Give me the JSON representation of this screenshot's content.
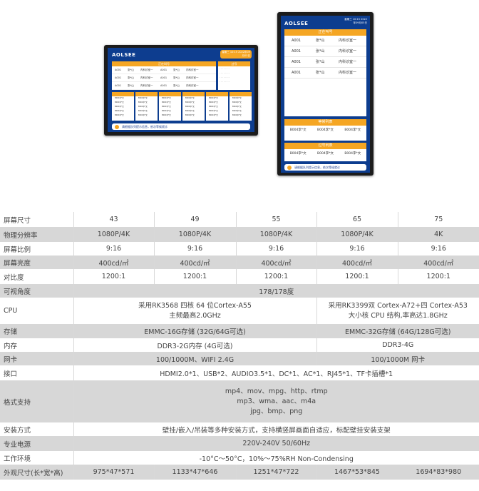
{
  "display": {
    "brand": "AOLSEE",
    "clock": "星期三 10:15 2022年09月05日",
    "sections": {
      "calling": "正在叫号",
      "waiting": "等候列表",
      "passed": "过号列表",
      "queue": "过号"
    },
    "calls": [
      {
        "id": "A001",
        "name": "张*山",
        "room": "内科诊室一"
      },
      {
        "id": "A001",
        "name": "张*山",
        "room": "内科诊室一"
      },
      {
        "id": "A001",
        "name": "张*山",
        "room": "内科诊室一"
      },
      {
        "id": "A001",
        "name": "张*山",
        "room": "内科诊室一"
      }
    ],
    "wait_items": [
      "B004李*文",
      "B004李*文",
      "B004李*文"
    ],
    "notice": "请根据队列提示信息，依次等候就诊"
  },
  "spec": {
    "rows": [
      {
        "label": "屏幕尺寸",
        "cells": [
          {
            "t": "43",
            "span": 1
          },
          {
            "t": "49",
            "span": 1
          },
          {
            "t": "55",
            "span": 1
          },
          {
            "t": "65",
            "span": 1
          },
          {
            "t": "75",
            "span": 1
          }
        ],
        "h": 21,
        "shade": "w"
      },
      {
        "label": "物理分辨率",
        "cells": [
          {
            "t": "1080P/4K",
            "span": 1
          },
          {
            "t": "1080P/4K",
            "span": 1
          },
          {
            "t": "1080P/4K",
            "span": 1
          },
          {
            "t": "1080P/4K",
            "span": 1
          },
          {
            "t": "4K",
            "span": 1
          }
        ],
        "h": 21,
        "shade": "g"
      },
      {
        "label": "屏幕比例",
        "cells": [
          {
            "t": "9:16",
            "span": 1
          },
          {
            "t": "9:16",
            "span": 1
          },
          {
            "t": "9:16",
            "span": 1
          },
          {
            "t": "9:16",
            "span": 1
          },
          {
            "t": "9:16",
            "span": 1
          }
        ],
        "h": 19,
        "shade": "w"
      },
      {
        "label": "屏幕亮度",
        "cells": [
          {
            "t": "400cd/㎡",
            "span": 1
          },
          {
            "t": "400cd/㎡",
            "span": 1
          },
          {
            "t": "400cd/㎡",
            "span": 1
          },
          {
            "t": "400cd/㎡",
            "span": 1
          },
          {
            "t": "400cd/㎡",
            "span": 1
          }
        ],
        "h": 19,
        "shade": "g"
      },
      {
        "label": "对比度",
        "cells": [
          {
            "t": "1200:1",
            "span": 1
          },
          {
            "t": "1200:1",
            "span": 1
          },
          {
            "t": "1200:1",
            "span": 1
          },
          {
            "t": "1200:1",
            "span": 1
          },
          {
            "t": "1200:1",
            "span": 1
          }
        ],
        "h": 21,
        "shade": "w"
      },
      {
        "label": "可视角度",
        "cells": [
          {
            "t": "178/178度",
            "span": 5
          }
        ],
        "h": 19,
        "shade": "g"
      },
      {
        "label": "CPU",
        "cells": [
          {
            "t": "采用RK3568 四核 64 位Cortex-A55\n主频最高2.0GHz",
            "span": 3
          },
          {
            "t": "采用RK3399双 Cortex-A72+四 Cortex-A53\n大小核 CPU 结构,率高达1.8GHz",
            "span": 2
          }
        ],
        "h": 37,
        "shade": "w"
      },
      {
        "label": "存储",
        "cells": [
          {
            "t": "EMMC-16G存储 (32G/64G可选)",
            "span": 3
          },
          {
            "t": "EMMC-32G存储 (64G/128G可选)",
            "span": 2
          }
        ],
        "h": 20,
        "shade": "g"
      },
      {
        "label": "内存",
        "cells": [
          {
            "t": "DDR3-2G内存 (4G可选)",
            "span": 3
          },
          {
            "t": "DDR3-4G",
            "span": 2
          }
        ],
        "h": 19,
        "shade": "w"
      },
      {
        "label": "网卡",
        "cells": [
          {
            "t": "100/1000M、WIFI 2.4G",
            "span": 3
          },
          {
            "t": "100/1000M 网卡",
            "span": 2
          }
        ],
        "h": 19,
        "shade": "g"
      },
      {
        "label": "接口",
        "cells": [
          {
            "t": "HDMI2.0*1、USB*2、AUDIO3.5*1、DC*1、AC*1、RJ45*1、TF卡插槽*1",
            "span": 5
          }
        ],
        "h": 21,
        "shade": "w"
      },
      {
        "label": "格式支持",
        "cells": [
          {
            "t": "mp4、mov、mpg、http、rtmp\nmp3、wma、aac、m4a\njpg、bmp、png",
            "span": 5
          }
        ],
        "h": 59,
        "shade": "g"
      },
      {
        "label": "安装方式",
        "cells": [
          {
            "t": "壁挂/嵌入/吊装等多种安装方式，支持横竖屏画面自适应，标配壁挂安装支架",
            "span": 5
          }
        ],
        "h": 19,
        "shade": "w"
      },
      {
        "label": "专业电源",
        "cells": [
          {
            "t": "220V-240V 50/60Hz",
            "span": 5
          }
        ],
        "h": 21,
        "shade": "g"
      },
      {
        "label": "工作环境",
        "cells": [
          {
            "t": "-10°C～50°C，10%～75%RH Non-Condensing",
            "span": 5
          }
        ],
        "h": 19,
        "shade": "w"
      },
      {
        "label": "外观尺寸(长*宽*高)",
        "cells": [
          {
            "t": "975*47*571",
            "span": 1
          },
          {
            "t": "1133*47*646",
            "span": 1
          },
          {
            "t": "1251*47*722",
            "span": 1
          },
          {
            "t": "1467*53*845",
            "span": 1
          },
          {
            "t": "1694*83*980",
            "span": 1
          }
        ],
        "h": 21,
        "shade": "g"
      }
    ]
  }
}
